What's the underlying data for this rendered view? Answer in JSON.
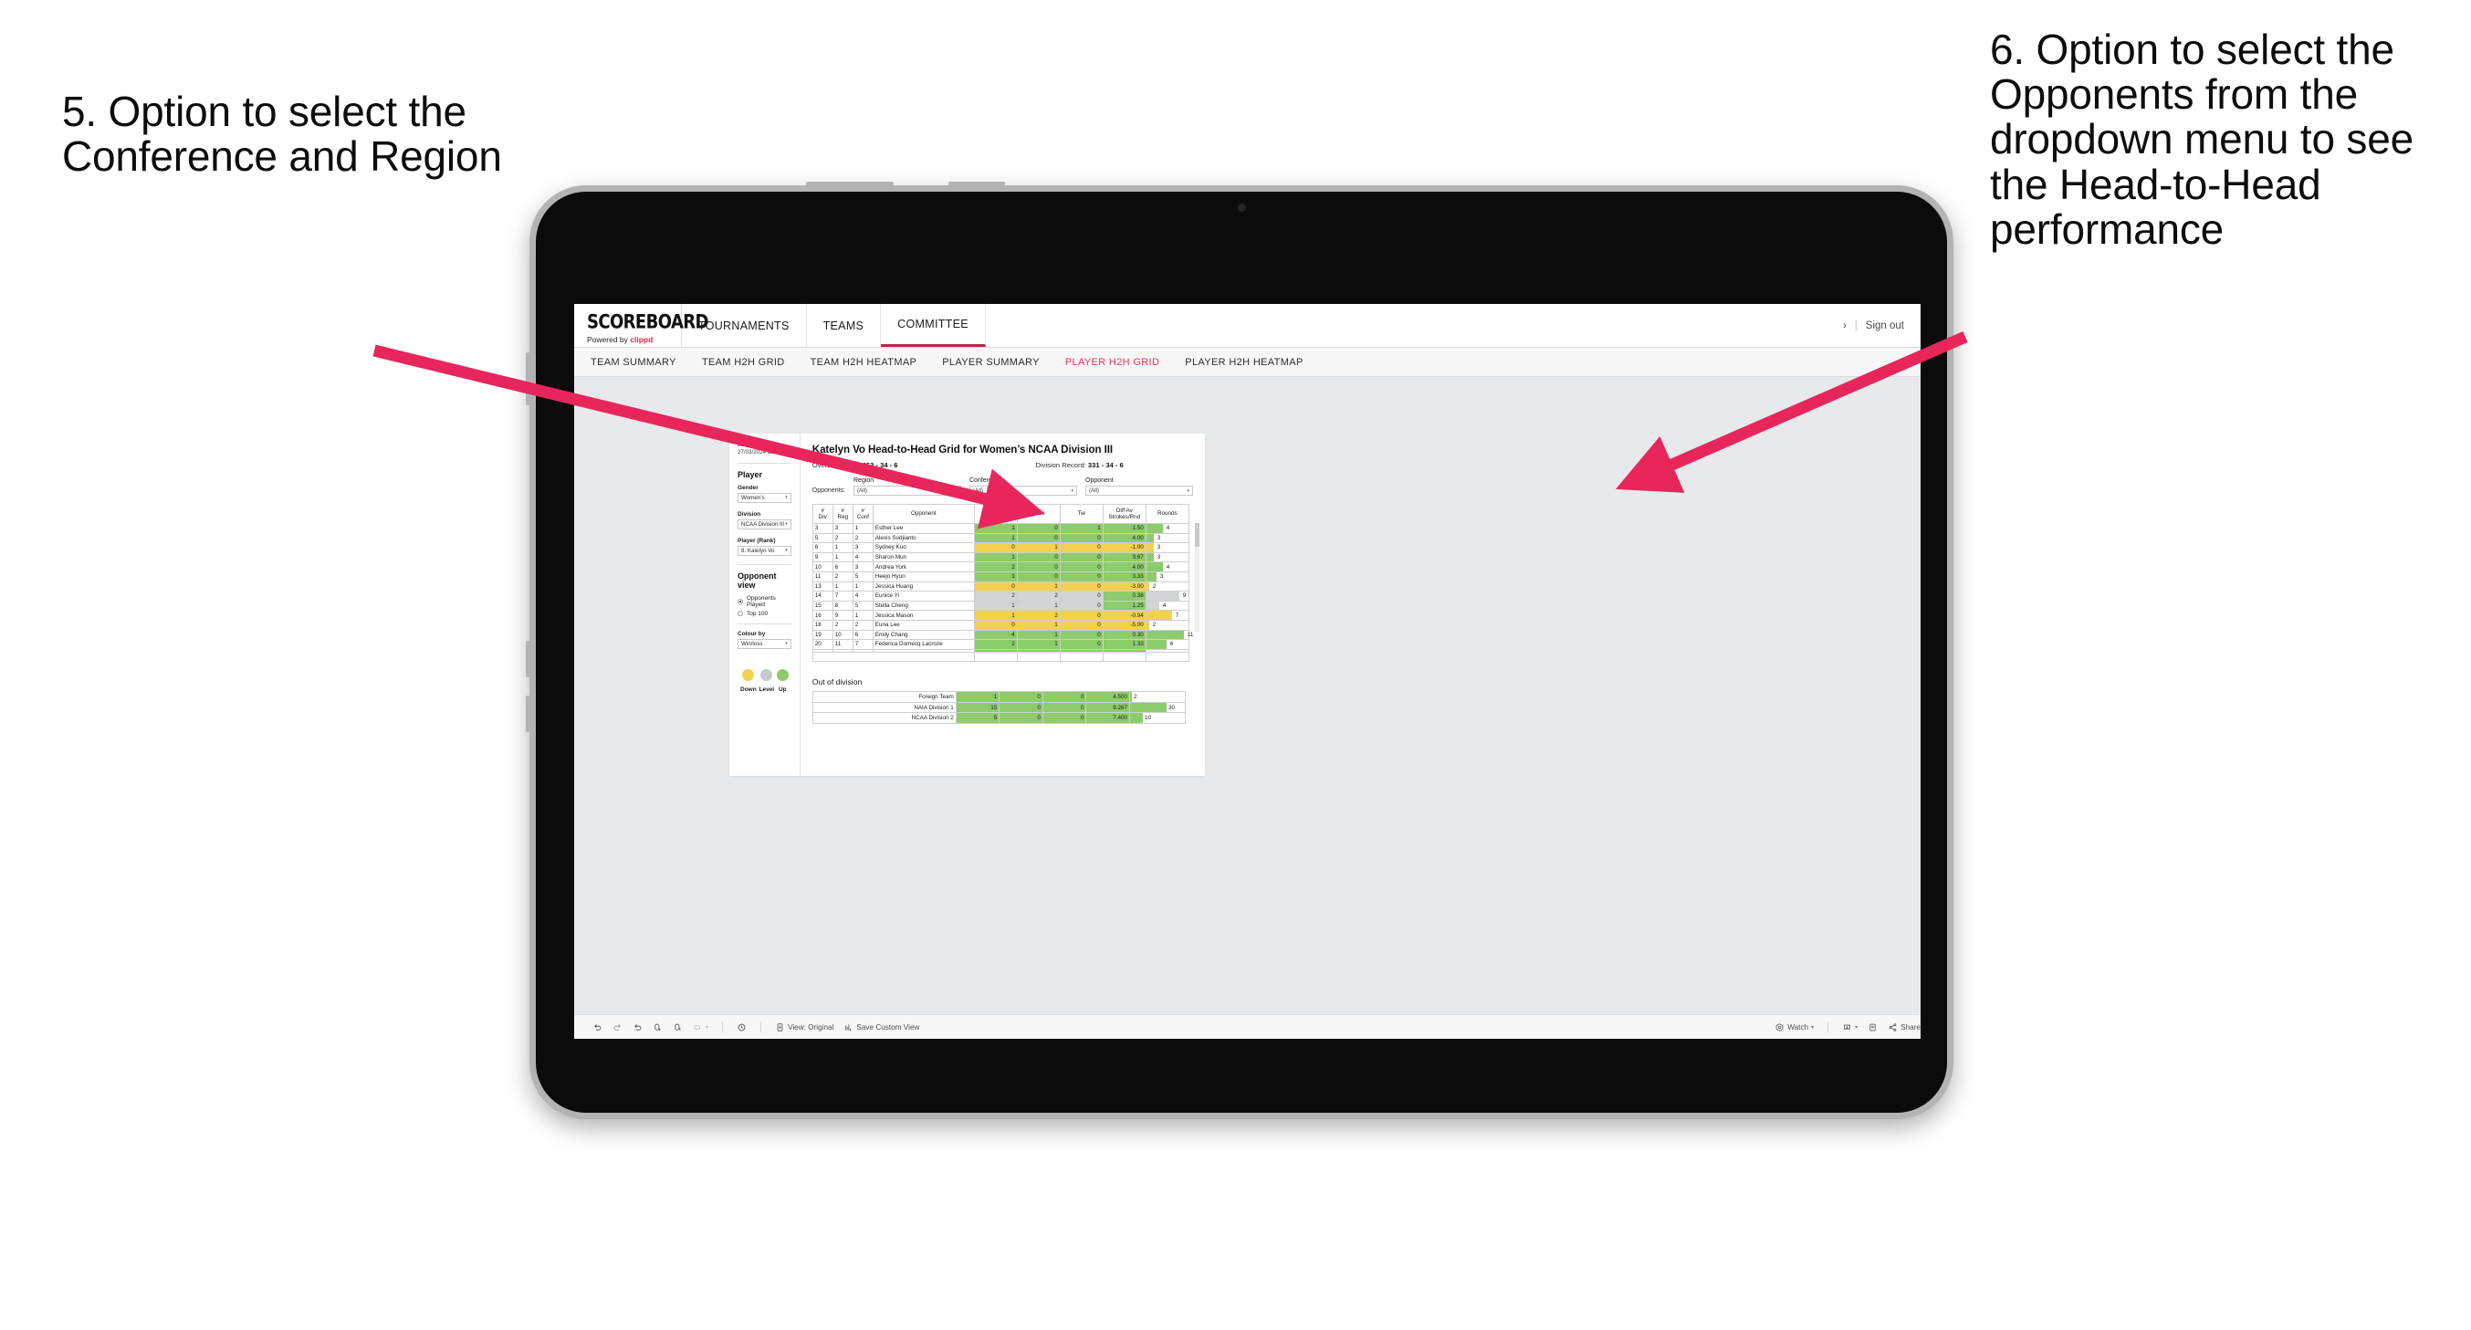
{
  "annotations": {
    "left": "5. Option to select the Conference and Region",
    "right": "6. Option to select the Opponents from the dropdown menu to see the Head-to-Head performance",
    "arrow_color": "#e8265c"
  },
  "app": {
    "logo": {
      "word": "SCOREBOARD",
      "powered_prefix": "Powered by ",
      "brand": "clippd"
    },
    "topnav": [
      {
        "label": "TOURNAMENTS",
        "active": false
      },
      {
        "label": "TEAMS",
        "active": false
      },
      {
        "label": "COMMITTEE",
        "active": true
      }
    ],
    "account": {
      "chevron": "›",
      "separator": "|",
      "signout": "Sign out"
    },
    "subnav": [
      {
        "label": "TEAM SUMMARY",
        "active": false
      },
      {
        "label": "TEAM H2H GRID",
        "active": false
      },
      {
        "label": "TEAM H2H HEATMAP",
        "active": false
      },
      {
        "label": "PLAYER SUMMARY",
        "active": false
      },
      {
        "label": "PLAYER H2H GRID",
        "active": true
      },
      {
        "label": "PLAYER H2H HEATMAP",
        "active": false
      }
    ]
  },
  "sidebar": {
    "last_updated": "Last Updated: 27/03/2024\n15:38",
    "player_heading": "Player",
    "gender": {
      "label": "Gender",
      "value": "Women’s"
    },
    "division": {
      "label": "Division",
      "value": "NCAA Division III"
    },
    "player_rank": {
      "label": "Player (Rank)",
      "value": "8. Katelyn Vo"
    },
    "opponent_view": {
      "heading": "Opponent view",
      "options": [
        {
          "label": "Opponents Played",
          "selected": true
        },
        {
          "label": "Top 100",
          "selected": false
        }
      ]
    },
    "colour_by": {
      "label": "Colour by",
      "value": "Win/loss"
    },
    "legend": [
      {
        "caption": "Down",
        "color": "#f2d14e"
      },
      {
        "caption": "Level",
        "color": "#c7cacd"
      },
      {
        "caption": "Up",
        "color": "#8ccc6a"
      }
    ]
  },
  "main": {
    "title": "Katelyn Vo Head-to-Head Grid for Women’s NCAA Division III",
    "overall_record": {
      "label": "Overall Record: ",
      "value": "353 - 34 - 6"
    },
    "division_record": {
      "label": "Division Record: ",
      "value": "331 - 34 - 6"
    },
    "filters_label": "Opponents:",
    "filters": [
      {
        "caption": "Region",
        "value": "(All)"
      },
      {
        "caption": "Conference",
        "value": "(All)"
      },
      {
        "caption": "Opponent",
        "value": "(All)"
      }
    ],
    "columns": [
      "# Div",
      "# Reg",
      "# Conf",
      "Opponent",
      "Win",
      "Loss",
      "Tie",
      "Diff Av Strokes/Rnd",
      "Rounds"
    ],
    "columns_split": [
      {
        "l1": "#",
        "l2": "Div"
      },
      {
        "l1": "#",
        "l2": "Reg"
      },
      {
        "l1": "#",
        "l2": "Conf"
      },
      {
        "l1": "Opponent",
        "l2": ""
      },
      {
        "l1": "Win",
        "l2": ""
      },
      {
        "l1": "Loss",
        "l2": ""
      },
      {
        "l1": "Tie",
        "l2": ""
      },
      {
        "l1": "Diff Av",
        "l2": "Strokes/Rnd"
      },
      {
        "l1": "Rounds",
        "l2": ""
      }
    ],
    "rows": [
      {
        "div": "3",
        "reg": "3",
        "conf": "1",
        "opponent": "Esther Lee",
        "win": "1",
        "loss": "0",
        "tie": "1",
        "diff": "1.50",
        "rounds": "4",
        "color": "#8ccc6a",
        "bar": 18
      },
      {
        "div": "5",
        "reg": "2",
        "conf": "2",
        "opponent": "Alexis Sudjianto",
        "win": "1",
        "loss": "0",
        "tie": "0",
        "diff": "4.00",
        "rounds": "3",
        "color": "#8ccc6a",
        "bar": 8
      },
      {
        "div": "6",
        "reg": "1",
        "conf": "3",
        "opponent": "Sydney Kuo",
        "win": "0",
        "loss": "1",
        "tie": "0",
        "diff": "-1.00",
        "rounds": "3",
        "color": "#f2d14e",
        "bar": 8
      },
      {
        "div": "9",
        "reg": "1",
        "conf": "4",
        "opponent": "Sharon Mun",
        "win": "1",
        "loss": "0",
        "tie": "0",
        "diff": "3.67",
        "rounds": "3",
        "color": "#8ccc6a",
        "bar": 8
      },
      {
        "div": "10",
        "reg": "6",
        "conf": "3",
        "opponent": "Andrea York",
        "win": "2",
        "loss": "0",
        "tie": "0",
        "diff": "4.00",
        "rounds": "4",
        "color": "#8ccc6a",
        "bar": 18
      },
      {
        "div": "11",
        "reg": "2",
        "conf": "5",
        "opponent": "Heejo Hyun",
        "win": "1",
        "loss": "0",
        "tie": "0",
        "diff": "3.33",
        "rounds": "3",
        "color": "#8ccc6a",
        "bar": 11
      },
      {
        "div": "13",
        "reg": "1",
        "conf": "1",
        "opponent": "Jessica Huang",
        "win": "0",
        "loss": "1",
        "tie": "0",
        "diff": "-3.00",
        "rounds": "2",
        "color": "#f2d14e",
        "bar": 3
      },
      {
        "div": "14",
        "reg": "7",
        "conf": "4",
        "opponent": "Eunice Yi",
        "win": "2",
        "loss": "2",
        "tie": "0",
        "diff": "0.38",
        "rounds": "9",
        "color": "#d2d4d6",
        "bar": 36,
        "diff_color": "#8ccc6a"
      },
      {
        "div": "15",
        "reg": "8",
        "conf": "5",
        "opponent": "Stella Cheng",
        "win": "1",
        "loss": "1",
        "tie": "0",
        "diff": "1.25",
        "rounds": "4",
        "color": "#d2d4d6",
        "bar": 14,
        "diff_color": "#8ccc6a"
      },
      {
        "div": "16",
        "reg": "9",
        "conf": "1",
        "opponent": "Jessica Mason",
        "win": "1",
        "loss": "2",
        "tie": "0",
        "diff": "-0.94",
        "rounds": "7",
        "color": "#f2d14e",
        "bar": 28
      },
      {
        "div": "18",
        "reg": "2",
        "conf": "2",
        "opponent": "Euna Lee",
        "win": "0",
        "loss": "1",
        "tie": "0",
        "diff": "-5.00",
        "rounds": "2",
        "color": "#f2d14e",
        "bar": 3
      },
      {
        "div": "19",
        "reg": "10",
        "conf": "6",
        "opponent": "Emily Chang",
        "win": "4",
        "loss": "1",
        "tie": "0",
        "diff": "0.30",
        "rounds": "11",
        "color": "#8ccc6a",
        "bar": 41
      },
      {
        "div": "20",
        "reg": "11",
        "conf": "7",
        "opponent": "Federica Domecq Lacroze",
        "win": "2",
        "loss": "1",
        "tie": "0",
        "diff": "1.33",
        "rounds": "6",
        "color": "#8ccc6a",
        "bar": 22
      }
    ],
    "out_of_division": {
      "title": "Out of division",
      "rows": [
        {
          "name": "Foreign Team",
          "win": "1",
          "loss": "0",
          "tie": "0",
          "diff": "4.500",
          "rounds": "2",
          "color": "#8ccc6a",
          "bar": 2
        },
        {
          "name": "NAIA Division 1",
          "win": "15",
          "loss": "0",
          "tie": "0",
          "diff": "9.267",
          "rounds": "30",
          "color": "#8ccc6a",
          "bar": 40
        },
        {
          "name": "NCAA Division 2",
          "win": "5",
          "loss": "0",
          "tie": "0",
          "diff": "7.400",
          "rounds": "10",
          "color": "#8ccc6a",
          "bar": 14
        }
      ]
    }
  },
  "toolbar": {
    "items": [
      {
        "name": "undo-icon",
        "label": ""
      },
      {
        "name": "redo-icon",
        "label": ""
      },
      {
        "name": "revert-icon",
        "label": ""
      },
      {
        "name": "refresh-data-icon",
        "label": ""
      },
      {
        "name": "pause-refresh-icon",
        "label": ""
      },
      {
        "name": "highlight-icon",
        "label": ""
      },
      {
        "name": "caret-down-icon",
        "label": ""
      },
      {
        "name": "history-icon",
        "label": ""
      },
      {
        "name": "view-original-icon",
        "label": "View: Original"
      },
      {
        "name": "save-custom-view-icon",
        "label": "Save Custom View"
      },
      {
        "name": "watch-icon",
        "label": "Watch"
      },
      {
        "name": "download-icon",
        "label": ""
      },
      {
        "name": "fullscreen-icon",
        "label": ""
      },
      {
        "name": "share-icon",
        "label": "Share"
      }
    ],
    "view_original": "View: Original",
    "save_custom_view": "Save Custom View",
    "watch": "Watch",
    "share": "Share",
    "caret": "▾"
  }
}
